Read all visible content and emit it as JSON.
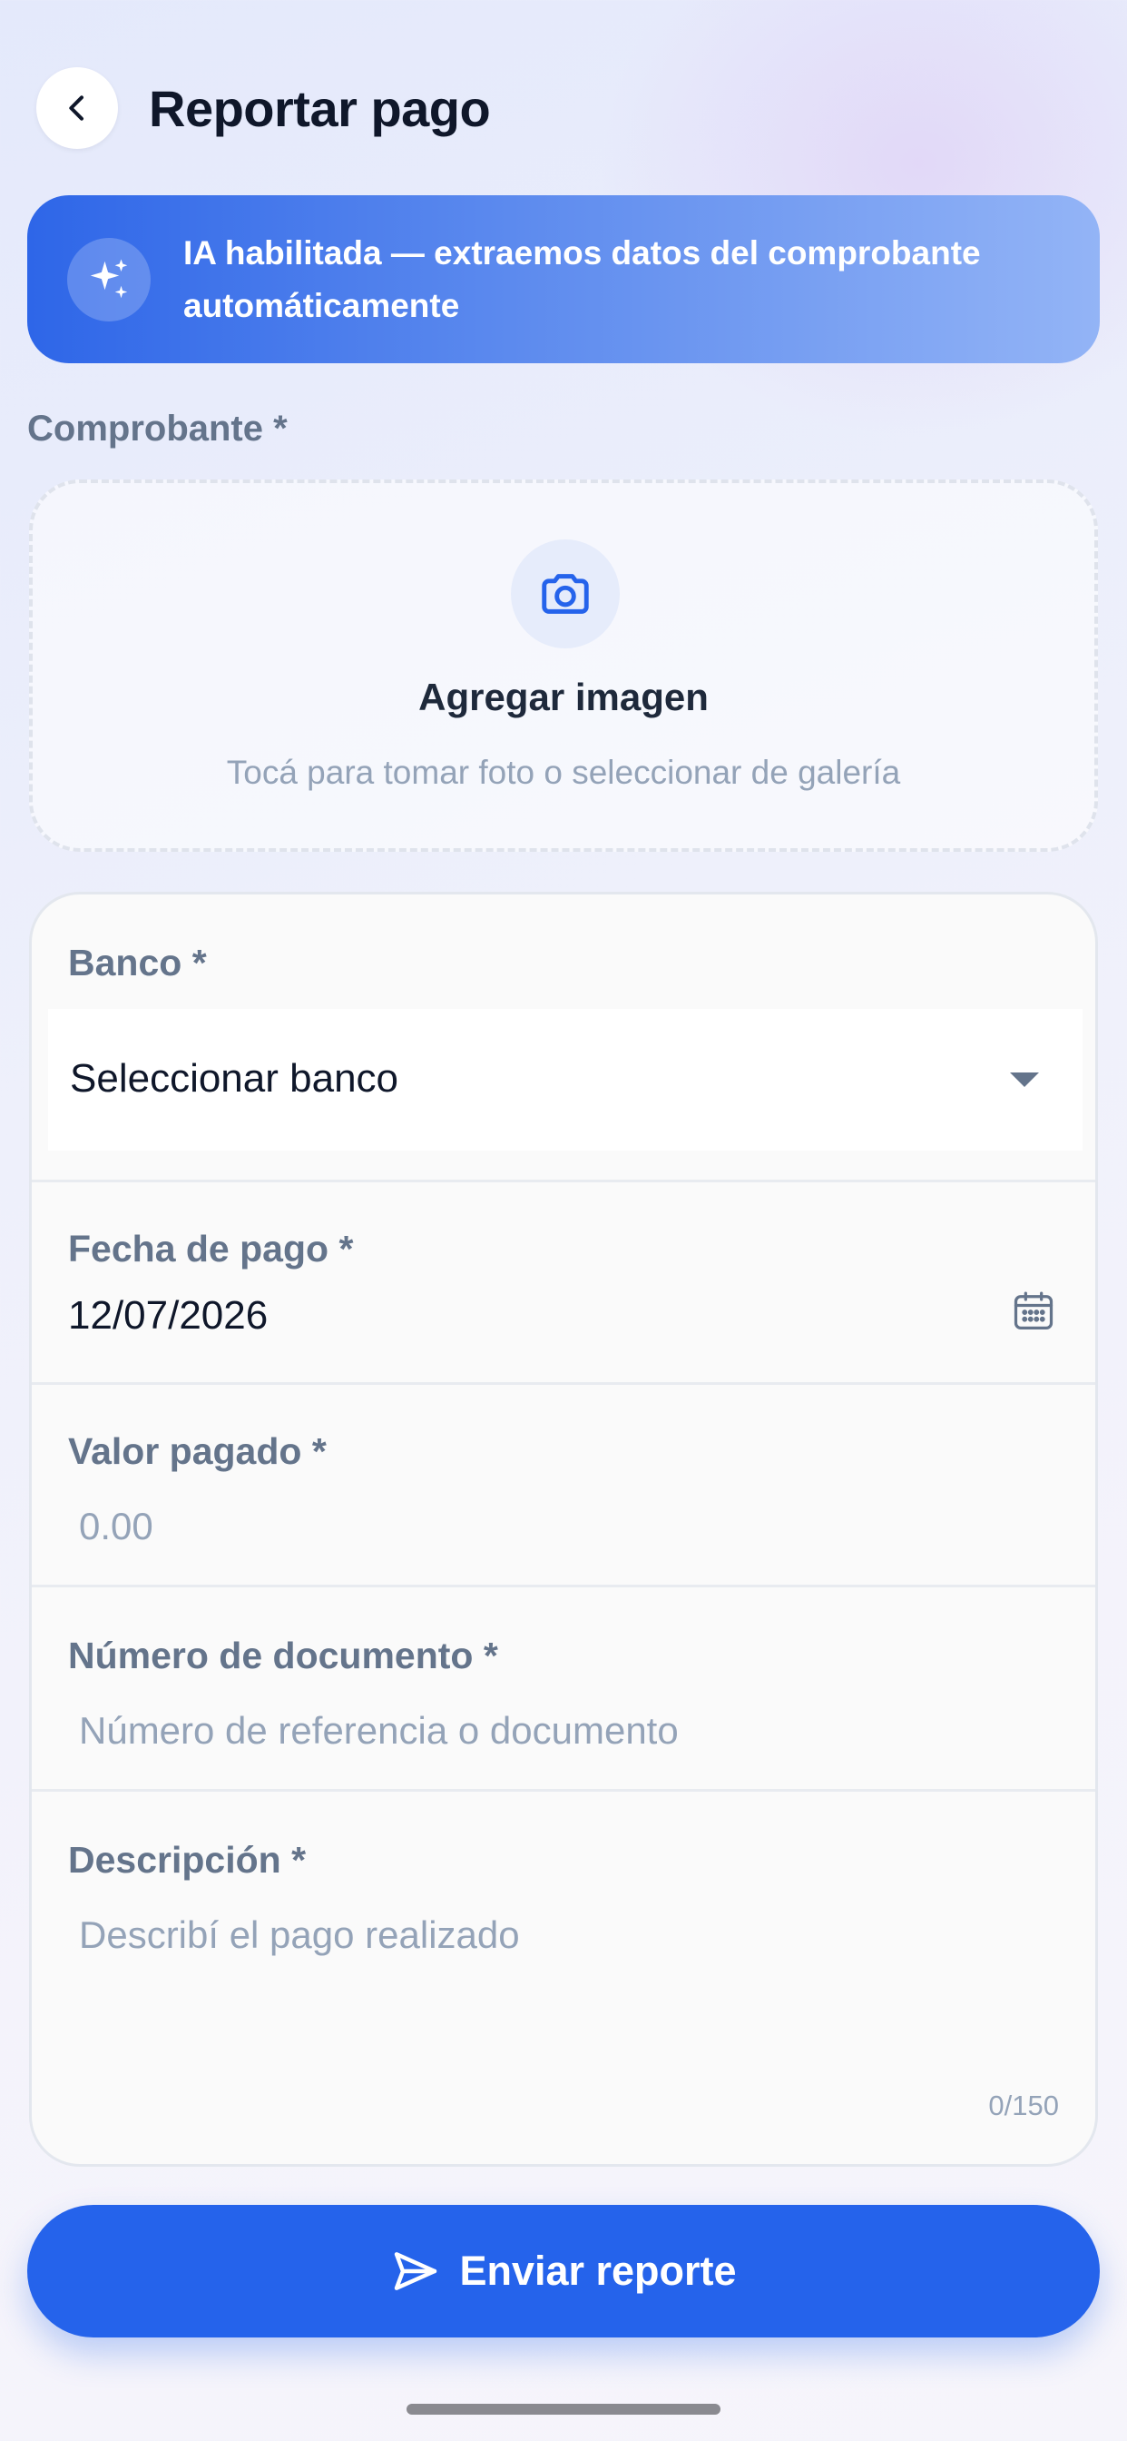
{
  "header": {
    "title": "Reportar pago",
    "back_icon": "chevron-left-icon"
  },
  "ai_banner": {
    "text": "IA habilitada — extraemos datos del comprobante automáticamente",
    "icon": "sparkles-icon"
  },
  "receipt": {
    "label": "Comprobante *",
    "icon": "camera-icon",
    "title": "Agregar imagen",
    "hint": "Tocá para tomar foto o seleccionar de galería"
  },
  "form": {
    "bank": {
      "label": "Banco *",
      "value": "Seleccionar banco",
      "icon": "caret-down-icon"
    },
    "payment_date": {
      "label": "Fecha de pago *",
      "value": "12/07/2026",
      "icon": "calendar-icon"
    },
    "amount": {
      "label": "Valor pagado *",
      "placeholder": "0.00"
    },
    "document_number": {
      "label": "Número de documento *",
      "placeholder": "Número de referencia o documento"
    },
    "description": {
      "label": "Descripción *",
      "placeholder": "Describí el pago realizado",
      "counter": "0/150"
    }
  },
  "submit": {
    "label": "Enviar reporte",
    "icon": "send-icon"
  },
  "colors": {
    "primary": "#2563eb",
    "label": "#64748b",
    "placeholder": "#94a3b8",
    "title": "#0f172a"
  }
}
